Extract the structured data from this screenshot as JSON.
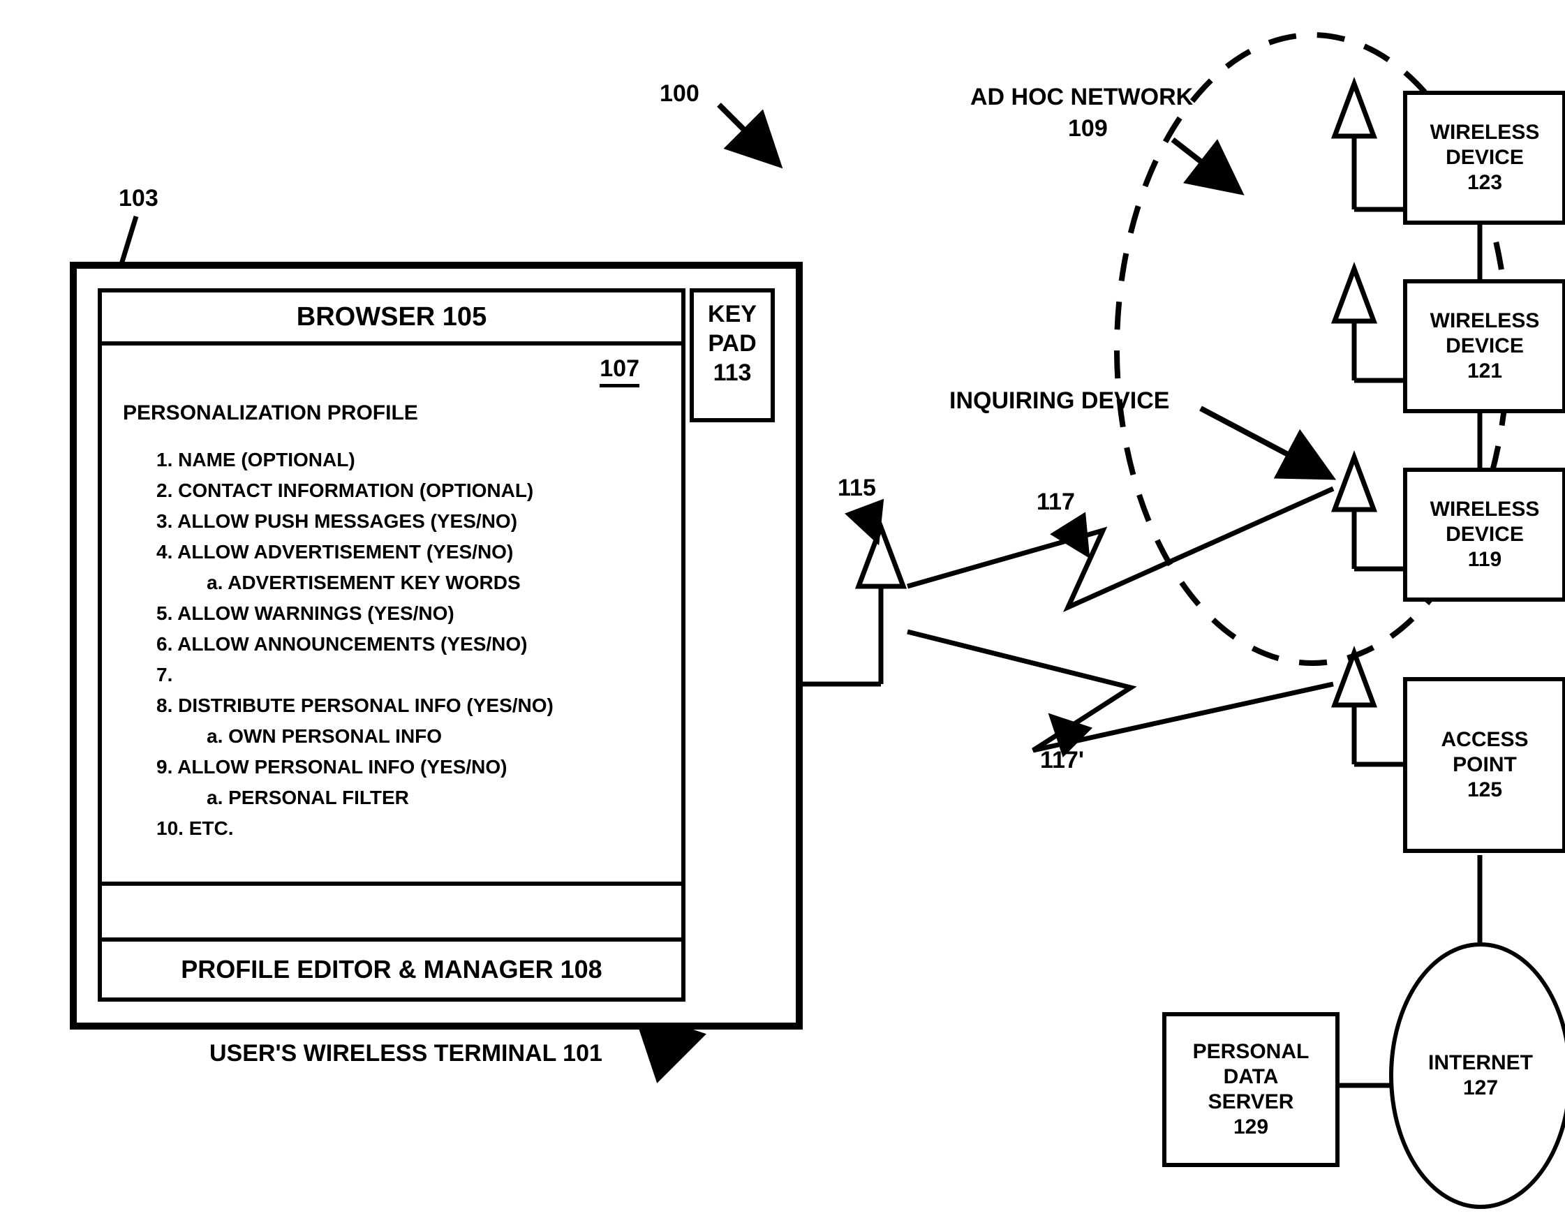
{
  "refs": {
    "r100": "100",
    "r103": "103",
    "r107": "107",
    "r109_a": "AD HOC NETWORK",
    "r109_b": "109",
    "r115": "115",
    "r117": "117",
    "r117p": "117'",
    "inquiring": "INQUIRING DEVICE"
  },
  "terminal": {
    "caption": "USER'S WIRELESS TERMINAL 101",
    "browser_title": "BROWSER 105",
    "profile_editor": "PROFILE EDITOR & MANAGER 108",
    "keypad_l1": "KEY",
    "keypad_l2": "PAD",
    "keypad_l3": "113"
  },
  "profile": {
    "heading": "PERSONALIZATION PROFILE",
    "items": [
      {
        "t": "1. NAME (OPTIONAL)",
        "i": 1
      },
      {
        "t": "2. CONTACT INFORMATION (OPTIONAL)",
        "i": 1
      },
      {
        "t": "3. ALLOW PUSH MESSAGES (YES/NO)",
        "i": 1
      },
      {
        "t": "4. ALLOW ADVERTISEMENT (YES/NO)",
        "i": 1
      },
      {
        "t": "a. ADVERTISEMENT KEY WORDS",
        "i": 2
      },
      {
        "t": "5. ALLOW WARNINGS (YES/NO)",
        "i": 1
      },
      {
        "t": "6. ALLOW ANNOUNCEMENTS (YES/NO)",
        "i": 1
      },
      {
        "t": "7.",
        "i": 1
      },
      {
        "t": "8. DISTRIBUTE PERSONAL INFO (YES/NO)",
        "i": 1
      },
      {
        "t": "a. OWN PERSONAL INFO",
        "i": 2
      },
      {
        "t": "9. ALLOW PERSONAL INFO (YES/NO)",
        "i": 1
      },
      {
        "t": "a. PERSONAL FILTER",
        "i": 2
      },
      {
        "t": "10. ETC.",
        "i": 1
      }
    ]
  },
  "devices": {
    "d123_l1": "WIRELESS",
    "d123_l2": "DEVICE",
    "d123_l3": "123",
    "d121_l1": "WIRELESS",
    "d121_l2": "DEVICE",
    "d121_l3": "121",
    "d119_l1": "WIRELESS",
    "d119_l2": "DEVICE",
    "d119_l3": "119",
    "ap_l1": "ACCESS",
    "ap_l2": "POINT",
    "ap_l3": "125",
    "pds_l1": "PERSONAL",
    "pds_l2": "DATA",
    "pds_l3": "SERVER",
    "pds_l4": "129",
    "internet_l1": "INTERNET",
    "internet_l2": "127"
  }
}
